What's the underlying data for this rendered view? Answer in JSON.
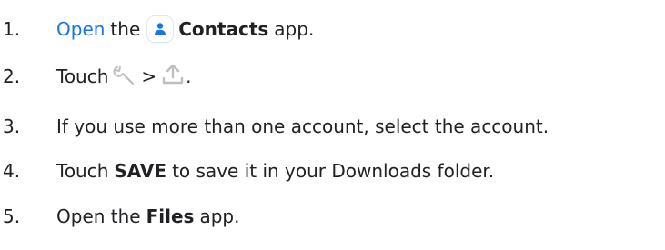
{
  "steps": [
    {
      "num": "1.",
      "link": "Open",
      "t1": "the",
      "app": "Contacts",
      "t2": "app."
    },
    {
      "num": "2.",
      "t1": "Touch",
      "sep": ">",
      "end": "."
    },
    {
      "num": "3.",
      "text": "If you use more than one account, select the account."
    },
    {
      "num": "4.",
      "t1": "Touch",
      "bold": "SAVE",
      "t2": "to save it in your Downloads folder."
    },
    {
      "num": "5.",
      "t1": "Open the",
      "bold": "Files",
      "t2": "app."
    }
  ],
  "icons": {
    "contacts": "contacts-app-icon",
    "wrench": "wrench-icon",
    "upload": "upload-icon"
  },
  "colors": {
    "link": "#1a73e8",
    "contacts_icon": "#1a73e8",
    "tool_icons": "#c4c7c5"
  }
}
